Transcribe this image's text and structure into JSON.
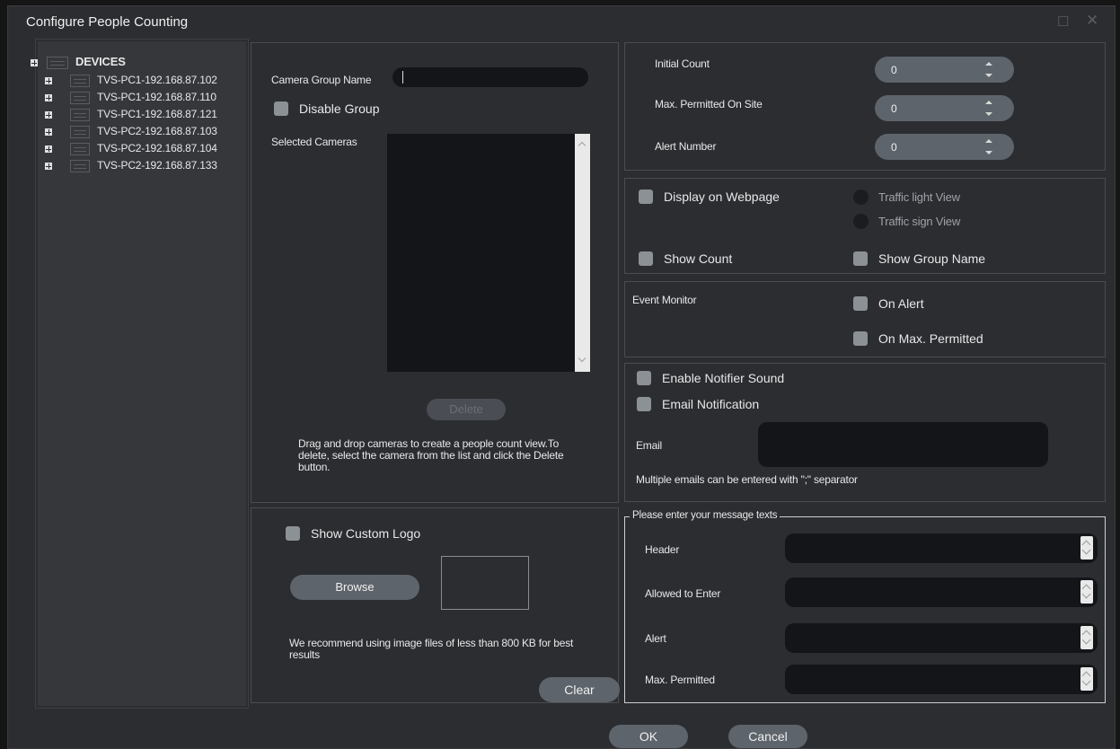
{
  "window": {
    "title": "Configure People Counting"
  },
  "tree": {
    "root_label": "DEVICES",
    "devices": [
      "TVS-PC1-192.168.87.102",
      "TVS-PC1-192.168.87.110",
      "TVS-PC1-192.168.87.121",
      "TVS-PC2-192.168.87.103",
      "TVS-PC2-192.168.87.104",
      "TVS-PC2-192.168.87.133"
    ]
  },
  "group": {
    "name_label": "Camera Group Name",
    "name_value": "",
    "disable_label": "Disable Group",
    "selected_cameras_label": "Selected Cameras",
    "delete_label": "Delete",
    "hint": "Drag and drop cameras to create a people count view.To delete, select the camera from the list and click the Delete button."
  },
  "logo": {
    "show_label": "Show Custom Logo",
    "browse_label": "Browse",
    "recommend": "We recommend using image files of less than 800 KB for best results",
    "clear_label": "Clear"
  },
  "counts": {
    "initial_label": "Initial Count",
    "initial_value": "0",
    "max_label": "Max. Permitted On Site",
    "max_value": "0",
    "alert_label": "Alert Number",
    "alert_value": "0"
  },
  "display": {
    "webpage_label": "Display on Webpage",
    "traffic_light_label": "Traffic light View",
    "traffic_sign_label": "Traffic sign View",
    "show_count_label": "Show Count",
    "show_group_name_label": "Show Group Name"
  },
  "events": {
    "label": "Event Monitor",
    "on_alert_label": "On Alert",
    "on_max_label": "On Max. Permitted"
  },
  "notify": {
    "sound_label": "Enable Notifier Sound",
    "email_notif_label": "Email Notification",
    "email_label": "Email",
    "email_hint": "Multiple emails can be entered with \";\" separator"
  },
  "messages": {
    "legend": "Please enter your message texts",
    "header_label": "Header",
    "allowed_label": "Allowed to Enter",
    "alert_label": "Alert",
    "max_label": "Max. Permitted"
  },
  "footer": {
    "ok_label": "OK",
    "cancel_label": "Cancel"
  },
  "colors": {
    "background": "#2b2d31",
    "input": "#141518",
    "button": "#5e646b",
    "checkbox": "#8c9196"
  }
}
